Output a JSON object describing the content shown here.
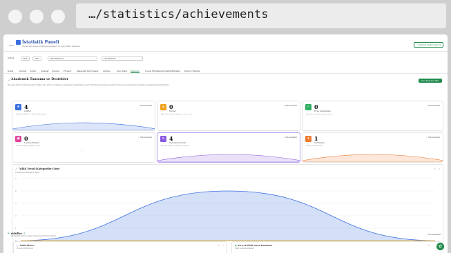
{
  "browser": {
    "url": "…/statistics/achievements"
  },
  "header": {
    "back_label": "‹ Geri",
    "title": "İstatistik Paneli",
    "subtitle": "Öğrencinin genel ilerleme istatistikleri ve performans analizleri",
    "refresh_label": "Verileri Senkronize Et"
  },
  "filters": {
    "label": "Dönem:",
    "year_start": "2024",
    "year_end": "2025",
    "faculty": "Tüm Fakülteler",
    "unit": "Tüm Birimler"
  },
  "tabs": [
    "Genel",
    "Dersler",
    "Notlar",
    "Sınavlar",
    "Ödevler",
    "Projeler",
    "Akademik Performans",
    "Aktivite",
    "Ders Takip",
    "Başarılar",
    "Sosyal Etkinlikler",
    "Gönüllülük/Stajlar",
    "Kariyer Hazırlık"
  ],
  "active_tab": "Başarılar",
  "section": {
    "title": "Akademik Tanınma ve Destekler",
    "description": "Bu sayfa öğrencinin kazandığı ödüller, ilk yerlere yerleşme ve akademik başarılarını içerir. Burada hem başarı sayılarını hem de performansın zamanla değişimini izleyebilirsiniz.",
    "action_label": "Yeni Kazanım Ekle"
  },
  "cards": [
    {
      "value": "4",
      "label": "Ödüller",
      "desc": "Akademik ödüller ve diğer ödül kayıtları",
      "select": "Tüm zamanlar",
      "color": "#3b6fe0",
      "icon": "trophy-icon",
      "glyph": "★"
    },
    {
      "value": "0",
      "label": "Burslar",
      "desc": "Öğrenim ücretinde indirim ve burs sayısı",
      "select": "Tüm zamanlar",
      "color": "#f0a020",
      "icon": "coin-icon",
      "glyph": "$",
      "empty": "—"
    },
    {
      "value": "0",
      "label": "Proje Tamamlama",
      "desc": "Başarıyla tamamlanan proje sayısı",
      "select": "Tüm zamanlar",
      "color": "#2fae5f",
      "icon": "check-icon",
      "glyph": "✓",
      "empty": "—"
    },
    {
      "value": "0",
      "label": "Toplantı Bilgileri",
      "desc": "Katılım sağlanan toplantı sayısı",
      "select": "Tüm zamanlar",
      "color": "#e0409a",
      "icon": "calendar-icon",
      "glyph": "▣",
      "empty": "—"
    },
    {
      "value": "4",
      "label": "Yayınlar/Sunumlar",
      "desc": "Hakemli dergi ve konferans yayınları",
      "select": "Tüm zamanlar",
      "color": "#8a5be0",
      "icon": "book-icon",
      "glyph": "≡"
    },
    {
      "value": "1",
      "label": "Sertifikalar",
      "desc": "Alınan sertifika sayısı",
      "select": "Tüm zamanlar",
      "color": "#f07a30",
      "icon": "certificate-icon",
      "glyph": "✦"
    }
  ],
  "trend": {
    "title": "Yıllık Trend (Kategoriler Göre)",
    "desc": "Yıllara göre kategori sayısı"
  },
  "chart_data": {
    "type": "area",
    "title": "Yıllık Trend (Kategoriler Göre)",
    "x": [
      "2023",
      "",
      "2025"
    ],
    "series": [
      {
        "name": "Ödüller",
        "color": "#3b6fe0",
        "values": [
          0,
          4,
          0
        ]
      },
      {
        "name": "Toplantı Bilgileri",
        "color": "#e0409a",
        "values": [
          0,
          0,
          0
        ]
      },
      {
        "name": "Proje Tamamlama",
        "color": "#2fae5f",
        "values": [
          0,
          0,
          0
        ]
      },
      {
        "name": "Burslar",
        "color": "#f0a020",
        "values": [
          0,
          0,
          0
        ]
      }
    ],
    "ylim": [
      0,
      5
    ]
  },
  "awards": {
    "title": "Ödüller",
    "count_badge": "4",
    "desc": "Akademik ödül ve diğer başarı kayıtlarının listesi.",
    "select": "Tüm zamanlar",
    "list_left_title": "Ödül Türleri",
    "list_left_desc": "En sık ödül türleri",
    "list_right_title": "En Çok Ödül Veren Kurumlar",
    "list_right_desc": "Ödül veren kurumlar"
  }
}
